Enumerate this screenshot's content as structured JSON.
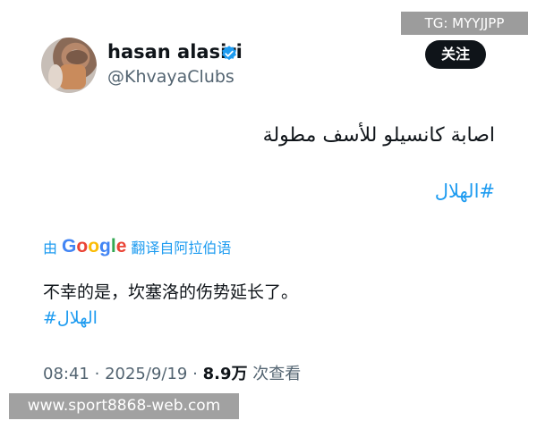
{
  "watermark_top": "TG: MYYJJPP",
  "watermark_bottom": "www.sport8868-web.com",
  "author": {
    "name": "hasan alasiri",
    "handle": "@KhvayaClubs"
  },
  "follow_button": "关注",
  "tweet": {
    "text": "اصابة كانسيلو للأسف مطولة",
    "hashtag": "#الهلال"
  },
  "translation": {
    "by": "由",
    "google_letters": [
      "G",
      "o",
      "o",
      "g",
      "l",
      "e"
    ],
    "action": "翻译自阿拉伯语",
    "text": "不幸的是，坎塞洛的伤势延长了。",
    "hashtag": "#الهلال"
  },
  "meta": {
    "time": "08:41",
    "sep": "·",
    "date": "2025/9/19",
    "views_count": "8.9万",
    "views_label": "次查看"
  },
  "colors": {
    "link": "#1d9bf0",
    "text": "#0f1419",
    "secondary": "#536471"
  }
}
